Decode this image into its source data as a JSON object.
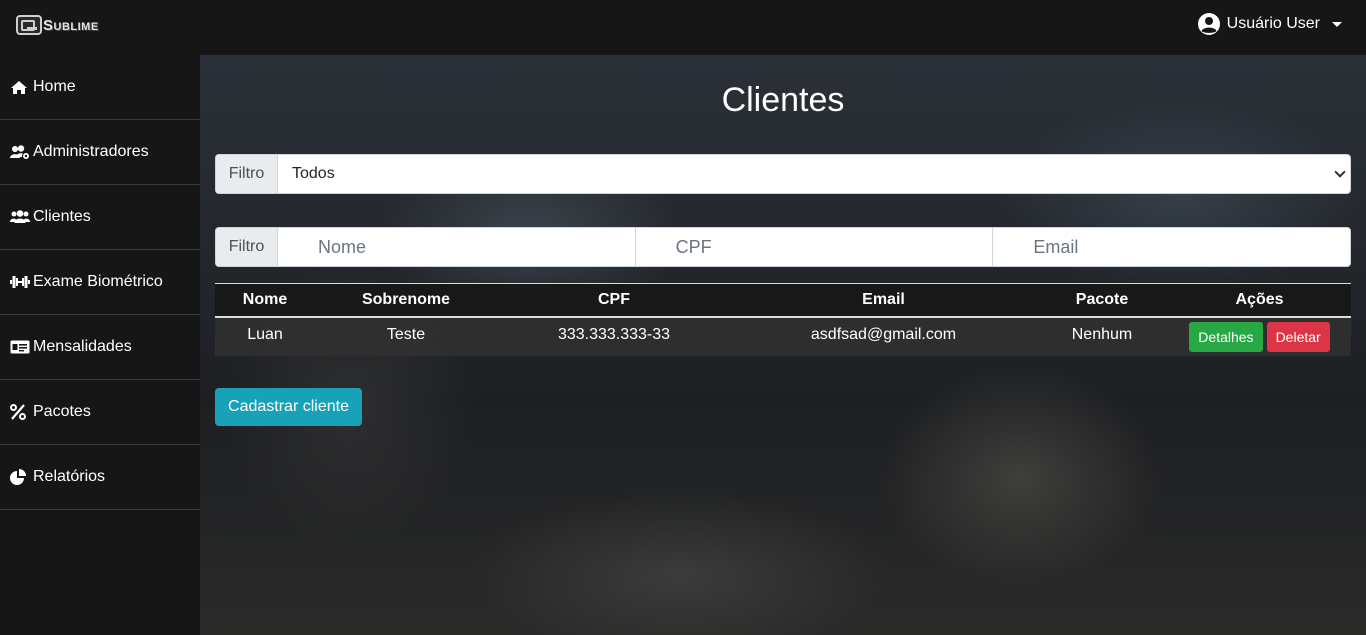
{
  "brand": {
    "name": "Sublime"
  },
  "user": {
    "label": "Usuário User"
  },
  "sidebar": {
    "items": [
      {
        "label": "Home",
        "icon": "home-icon"
      },
      {
        "label": "Administradores",
        "icon": "users-cog-icon"
      },
      {
        "label": "Clientes",
        "icon": "users-icon"
      },
      {
        "label": "Exame Biométrico",
        "icon": "dumbbell-icon"
      },
      {
        "label": "Mensalidades",
        "icon": "id-card-icon"
      },
      {
        "label": "Pacotes",
        "icon": "percent-icon"
      },
      {
        "label": "Relatórios",
        "icon": "pie-chart-icon"
      }
    ]
  },
  "main": {
    "title": "Clientes",
    "filter_select": {
      "addon": "Filtro",
      "selected": "Todos"
    },
    "filter_search": {
      "addon": "Filtro",
      "nome_placeholder": "Nome",
      "cpf_placeholder": "CPF",
      "email_placeholder": "Email"
    },
    "table": {
      "headers": [
        "Nome",
        "Sobrenome",
        "CPF",
        "Email",
        "Pacote",
        "Ações"
      ],
      "rows": [
        {
          "nome": "Luan",
          "sobrenome": "Teste",
          "cpf": "333.333.333-33",
          "email": "asdfsad@gmail.com",
          "pacote": "Nenhum"
        }
      ],
      "details_label": "Detalhes",
      "delete_label": "Deletar"
    },
    "register_label": "Cadastrar cliente"
  },
  "colors": {
    "success": "#28a745",
    "danger": "#dc3545",
    "info": "#17a2b8",
    "sidebar_bg": "#161616"
  }
}
